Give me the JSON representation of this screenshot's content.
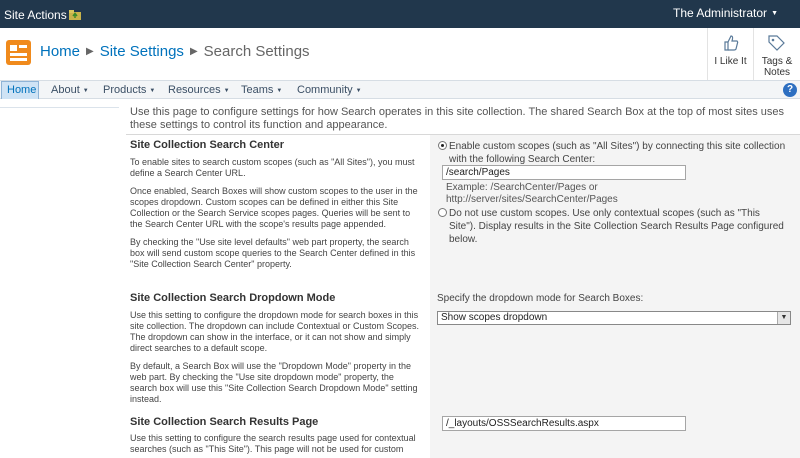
{
  "topbar": {
    "site_actions": "Site Actions",
    "user_name": "The Administrator",
    "navigate_up_icon": "folder-up-icon"
  },
  "breadcrumb": {
    "home": "Home",
    "site_settings": "Site Settings",
    "current": "Search Settings"
  },
  "social": {
    "i_like_it": "I Like It",
    "tags_notes": "Tags & Notes"
  },
  "nav": {
    "home": "Home",
    "items": [
      "About",
      "Products",
      "Resources",
      "Teams",
      "Community"
    ]
  },
  "intro": "Use this page to configure settings for how Search operates in this site collection.  The shared Search Box at the top of most sites uses these settings to control its function and appearance.",
  "search_center": {
    "title": "Site Collection Search Center",
    "desc": [
      "To enable sites to search custom scopes (such as \"All Sites\"), you must define a Search Center URL.",
      "Once enabled, Search Boxes will show custom scopes to the user in the scopes dropdown.  Custom scopes can be defined in either this Site Collection or the Search Service scopes pages.  Queries will be sent to the Search Center URL with the scope's results page appended.",
      "By checking the \"Use site level defaults\" web part property, the search box will send custom scope queries to the Search Center defined in this \"Site Collection Search Center\" property."
    ],
    "option_enable": "Enable custom scopes (such as \"All Sites\") by connecting this site collection with the following Search Center:",
    "url_value": "/search/Pages",
    "example": "Example: /SearchCenter/Pages or http://server/sites/SearchCenter/Pages",
    "option_disable": "Do not use custom scopes. Use only contextual scopes (such as \"This Site\"). Display results in the Site Collection Search Results Page configured below."
  },
  "dropdown_mode": {
    "title": "Site Collection Search Dropdown Mode",
    "desc": [
      "Use this setting to configure the dropdown mode for search boxes in this site collection.  The dropdown can include Contextual or Custom Scopes.  The dropdown can show in the interface, or it can not show and simply direct searches to a default scope.",
      "By default, a Search Box will use the \"Dropdown Mode\" property in the web part.  By checking the \"Use site dropdown mode\" property, the search box will use this \"Site Collection Search Dropdown Mode\" setting instead."
    ],
    "label": "Specify the dropdown mode for Search Boxes:",
    "selected": "Show scopes dropdown"
  },
  "results_page": {
    "title": "Site Collection Search Results Page",
    "desc": "Use this setting to configure the search results page used for contextual searches (such as \"This Site\").  This page will not be used for custom scopes.",
    "url_value": "/_layouts/OSSSearchResults.aspx"
  },
  "colors": {
    "topbar": "#21374c",
    "link": "#0072bc",
    "nav_bg": "#f3f5f7",
    "right_panel": "#f4f4f4"
  }
}
